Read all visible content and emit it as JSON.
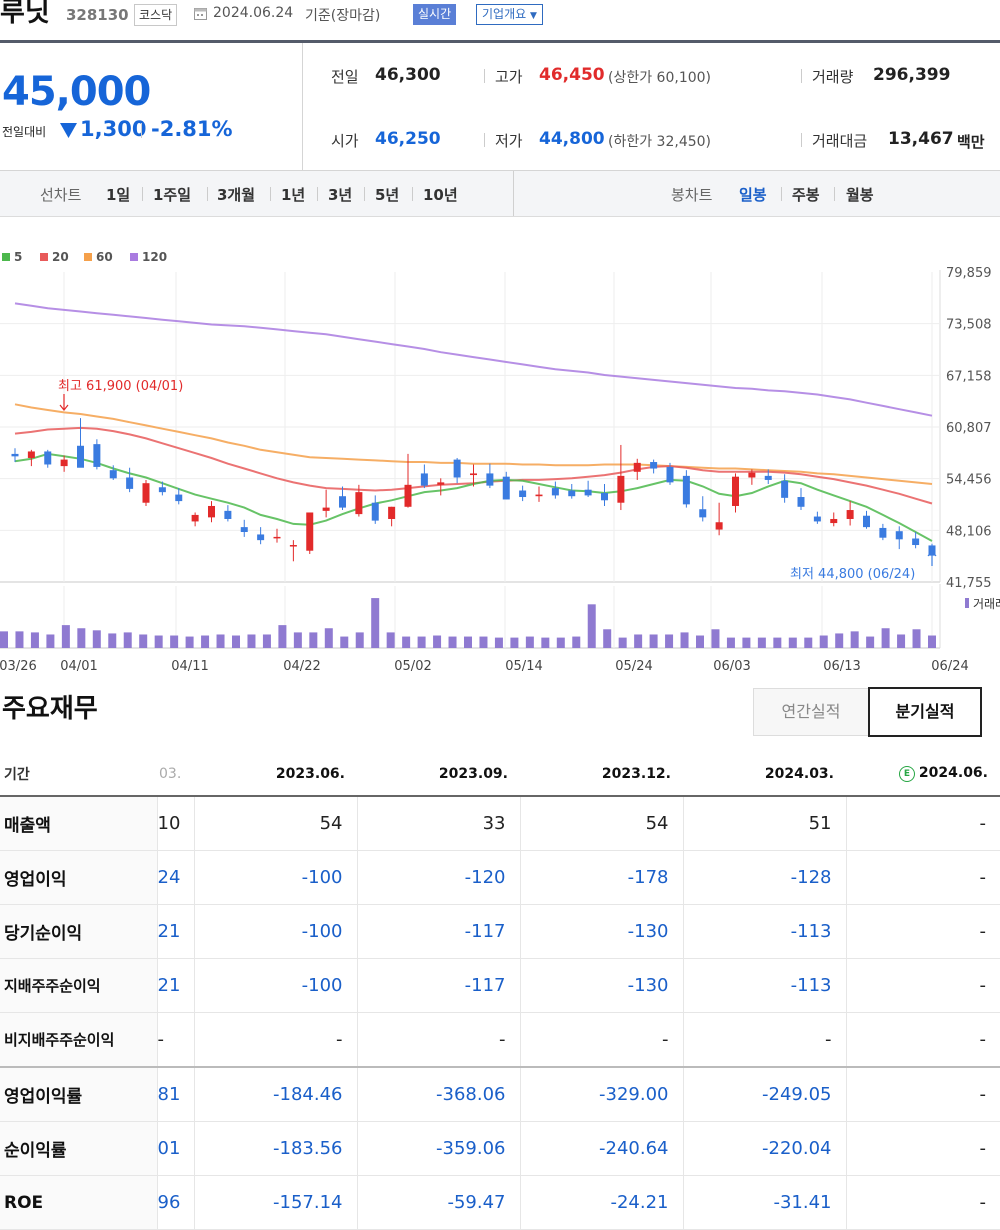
{
  "header": {
    "stock_name": "루닛",
    "stock_code": "328130",
    "market": "코스닥",
    "base_date": "2024.06.24",
    "base_label": "기준(장마감)",
    "realtime_label": "실시간",
    "company_label": "기업개요"
  },
  "price": {
    "current": "45,000",
    "change_label": "전일대비",
    "change_amount": "1,300",
    "change_rate": "-2.81%",
    "prev_close_label": "전일",
    "prev_close": "46,300",
    "open_label": "시가",
    "open": "46,250",
    "high_label": "고가",
    "high": "46,450",
    "upper_limit": "(상한가 60,100)",
    "low_label": "저가",
    "low": "44,800",
    "lower_limit": "(하한가 32,450)",
    "volume_label": "거래량",
    "volume": "296,399",
    "amount_label": "거래대금",
    "amount": "13,467",
    "amount_unit": "백만"
  },
  "period_bar": {
    "line_label": "선차트",
    "line_items": [
      "1일",
      "1주일",
      "3개월",
      "1년",
      "3년",
      "5년",
      "10년"
    ],
    "candle_label": "봉차트",
    "candle_items": [
      "일봉",
      "주봉",
      "월봉"
    ],
    "active_candle": "일봉"
  },
  "chart_data": {
    "type": "candlestick",
    "legend": [
      {
        "name": "5",
        "color": "#4cb84c"
      },
      {
        "name": "20",
        "color": "#e85a5a"
      },
      {
        "name": "60",
        "color": "#f5a04a"
      },
      {
        "name": "120",
        "color": "#a97be0"
      }
    ],
    "y_ticks": [
      "79,859",
      "73,508",
      "67,158",
      "60,807",
      "54,456",
      "48,106",
      "41,755"
    ],
    "ylim": [
      41755,
      79859
    ],
    "x_ticks": [
      "03/26",
      "04/01",
      "04/11",
      "04/22",
      "05/02",
      "05/14",
      "05/24",
      "06/03",
      "06/13",
      "06/24"
    ],
    "high_annotation": "최고 61,900 (04/01)",
    "low_annotation": "최저 44,800 (06/24)",
    "volume_label": "거래래",
    "candles": [
      {
        "o": 57500,
        "h": 58200,
        "l": 56500,
        "c": 57200
      },
      {
        "o": 57000,
        "h": 58000,
        "l": 56000,
        "c": 57800
      },
      {
        "o": 57800,
        "h": 58000,
        "l": 55800,
        "c": 56200
      },
      {
        "o": 56000,
        "h": 57300,
        "l": 55300,
        "c": 56800
      },
      {
        "o": 58500,
        "h": 61900,
        "l": 56300,
        "c": 55800
      },
      {
        "o": 58700,
        "h": 59300,
        "l": 55600,
        "c": 55900
      },
      {
        "o": 55500,
        "h": 56100,
        "l": 54300,
        "c": 54500
      },
      {
        "o": 54600,
        "h": 55800,
        "l": 52800,
        "c": 53200
      },
      {
        "o": 51500,
        "h": 54300,
        "l": 51100,
        "c": 53900
      },
      {
        "o": 53400,
        "h": 54100,
        "l": 52400,
        "c": 52800
      },
      {
        "o": 52500,
        "h": 53300,
        "l": 51300,
        "c": 51700
      },
      {
        "o": 49200,
        "h": 50300,
        "l": 48600,
        "c": 50000
      },
      {
        "o": 49700,
        "h": 51700,
        "l": 49100,
        "c": 51100
      },
      {
        "o": 50500,
        "h": 51200,
        "l": 49200,
        "c": 49500
      },
      {
        "o": 48500,
        "h": 49400,
        "l": 47300,
        "c": 47900
      },
      {
        "o": 47600,
        "h": 48500,
        "l": 46400,
        "c": 46900
      },
      {
        "o": 47200,
        "h": 48300,
        "l": 46600,
        "c": 47300
      },
      {
        "o": 46300,
        "h": 46900,
        "l": 44300,
        "c": 46300
      },
      {
        "o": 45600,
        "h": 50300,
        "l": 45200,
        "c": 50300
      },
      {
        "o": 50500,
        "h": 53100,
        "l": 49700,
        "c": 50900
      },
      {
        "o": 52300,
        "h": 53500,
        "l": 50600,
        "c": 50900
      },
      {
        "o": 50100,
        "h": 53700,
        "l": 49800,
        "c": 52800
      },
      {
        "o": 51500,
        "h": 52400,
        "l": 48900,
        "c": 49300
      },
      {
        "o": 49500,
        "h": 51000,
        "l": 48600,
        "c": 51000
      },
      {
        "o": 51000,
        "h": 57500,
        "l": 50900,
        "c": 53700
      },
      {
        "o": 55100,
        "h": 56200,
        "l": 53300,
        "c": 53600
      },
      {
        "o": 53700,
        "h": 54500,
        "l": 52400,
        "c": 54000
      },
      {
        "o": 56800,
        "h": 57000,
        "l": 53900,
        "c": 54600
      },
      {
        "o": 54900,
        "h": 56200,
        "l": 53500,
        "c": 55100
      },
      {
        "o": 55100,
        "h": 56300,
        "l": 53300,
        "c": 53600
      },
      {
        "o": 54700,
        "h": 55300,
        "l": 51900,
        "c": 51900
      },
      {
        "o": 53000,
        "h": 53600,
        "l": 51700,
        "c": 52200
      },
      {
        "o": 52300,
        "h": 53500,
        "l": 51600,
        "c": 52500
      },
      {
        "o": 53300,
        "h": 54100,
        "l": 52000,
        "c": 52400
      },
      {
        "o": 53000,
        "h": 53800,
        "l": 52000,
        "c": 52300
      },
      {
        "o": 53100,
        "h": 54200,
        "l": 52200,
        "c": 52400
      },
      {
        "o": 52700,
        "h": 53800,
        "l": 51100,
        "c": 51800
      },
      {
        "o": 51500,
        "h": 58600,
        "l": 50600,
        "c": 54800
      },
      {
        "o": 55300,
        "h": 56900,
        "l": 54300,
        "c": 56400
      },
      {
        "o": 56500,
        "h": 56800,
        "l": 55100,
        "c": 55700
      },
      {
        "o": 55900,
        "h": 56400,
        "l": 53700,
        "c": 54000
      },
      {
        "o": 54800,
        "h": 55500,
        "l": 50900,
        "c": 51300
      },
      {
        "o": 50700,
        "h": 52300,
        "l": 49200,
        "c": 49700
      },
      {
        "o": 48200,
        "h": 51500,
        "l": 47500,
        "c": 49100
      },
      {
        "o": 51100,
        "h": 55100,
        "l": 50300,
        "c": 54700
      },
      {
        "o": 54600,
        "h": 55600,
        "l": 53700,
        "c": 55200
      },
      {
        "o": 54800,
        "h": 55600,
        "l": 53800,
        "c": 54300
      },
      {
        "o": 54200,
        "h": 55000,
        "l": 51500,
        "c": 52100
      },
      {
        "o": 52200,
        "h": 53300,
        "l": 50600,
        "c": 51000
      },
      {
        "o": 49800,
        "h": 50400,
        "l": 48900,
        "c": 49200
      },
      {
        "o": 49000,
        "h": 50300,
        "l": 48600,
        "c": 49500
      },
      {
        "o": 49500,
        "h": 51700,
        "l": 48700,
        "c": 50600
      },
      {
        "o": 49900,
        "h": 50500,
        "l": 48300,
        "c": 48500
      },
      {
        "o": 48400,
        "h": 48900,
        "l": 46900,
        "c": 47200
      },
      {
        "o": 48000,
        "h": 48600,
        "l": 45800,
        "c": 47000
      },
      {
        "o": 47100,
        "h": 47900,
        "l": 45900,
        "c": 46300
      },
      {
        "o": 46250,
        "h": 46450,
        "l": 44800,
        "c": 45000
      }
    ],
    "ma5": [
      56600,
      56900,
      57500,
      57200,
      56900,
      56400,
      55700,
      55100,
      54600,
      53900,
      53200,
      52500,
      52000,
      51500,
      50900,
      50000,
      49500,
      48900,
      48800,
      49300,
      50100,
      50800,
      51400,
      51800,
      52300,
      52800,
      53000,
      53300,
      53800,
      54200,
      54300,
      54200,
      53800,
      53400,
      53000,
      52900,
      52700,
      52900,
      53300,
      53800,
      54300,
      54200,
      53500,
      52600,
      52300,
      52700,
      53500,
      54200,
      53900,
      53100,
      52400,
      51700,
      51000,
      50000,
      49000,
      47900,
      46800
    ],
    "ma20": [
      60000,
      60200,
      60500,
      60600,
      60700,
      60600,
      60300,
      59900,
      59400,
      58800,
      58200,
      57600,
      57000,
      56300,
      55700,
      55100,
      54500,
      54000,
      53600,
      53300,
      53200,
      53100,
      53000,
      53100,
      53300,
      53500,
      53700,
      53800,
      53900,
      54100,
      54200,
      54300,
      54300,
      54400,
      54500,
      54700,
      54900,
      55200,
      55600,
      55900,
      56000,
      55800,
      55500,
      55300,
      55300,
      55300,
      55300,
      55200,
      55000,
      54700,
      54400,
      54000,
      53600,
      53100,
      52600,
      52000,
      51400
    ],
    "ma60": [
      63600,
      63200,
      62900,
      62600,
      62400,
      62100,
      61800,
      61400,
      61000,
      60600,
      60200,
      59800,
      59400,
      58900,
      58500,
      58000,
      57700,
      57400,
      57100,
      57000,
      56900,
      56800,
      56700,
      56600,
      56500,
      56500,
      56400,
      56400,
      56300,
      56300,
      56300,
      56200,
      56200,
      56100,
      56100,
      56100,
      56200,
      56200,
      56200,
      56100,
      56000,
      55900,
      55800,
      55700,
      55700,
      55600,
      55500,
      55400,
      55300,
      55100,
      55000,
      54800,
      54600,
      54400,
      54200,
      54000,
      53800
    ],
    "ma120": [
      76000,
      75700,
      75400,
      75200,
      75000,
      74800,
      74600,
      74400,
      74200,
      74000,
      73800,
      73600,
      73400,
      73300,
      73200,
      73000,
      72800,
      72600,
      72400,
      72200,
      71900,
      71600,
      71300,
      71000,
      70700,
      70400,
      70000,
      69700,
      69400,
      69100,
      68800,
      68500,
      68200,
      67900,
      67700,
      67500,
      67200,
      67000,
      66800,
      66600,
      66400,
      66200,
      66000,
      65800,
      65600,
      65500,
      65300,
      65200,
      65000,
      64800,
      64500,
      64200,
      63800,
      63400,
      63000,
      62600,
      62200
    ],
    "volumes": [
      16,
      16,
      15,
      13,
      22,
      19,
      17,
      14,
      15,
      13,
      12,
      12,
      11,
      12,
      13,
      12,
      13,
      13,
      22,
      15,
      15,
      19,
      11,
      15,
      48,
      15,
      11,
      11,
      12,
      11,
      11,
      11,
      10,
      10,
      11,
      10,
      10,
      11,
      42,
      18,
      10,
      13,
      13,
      13,
      15,
      12,
      18,
      10,
      10,
      10,
      10,
      10,
      10,
      12,
      14,
      16,
      11,
      19,
      13,
      18,
      12
    ]
  },
  "financials": {
    "title": "주요재무",
    "tab_annual": "연간실적",
    "tab_quarter": "분기실적",
    "header_label": "기간",
    "columns": [
      "03.",
      "2023.06.",
      "2023.09.",
      "2023.12.",
      "2024.03.",
      "2024.06."
    ],
    "estimate_icon": "E",
    "rows": [
      {
        "label": "매출액",
        "values": [
          "10",
          "54",
          "33",
          "54",
          "51",
          "-"
        ]
      },
      {
        "label": "영업이익",
        "values": [
          "24",
          "-100",
          "-120",
          "-178",
          "-128",
          "-"
        ]
      },
      {
        "label": "당기순이익",
        "values": [
          "21",
          "-100",
          "-117",
          "-130",
          "-113",
          "-"
        ]
      },
      {
        "label": "지배주주순이익",
        "values": [
          "21",
          "-100",
          "-117",
          "-130",
          "-113",
          "-"
        ]
      },
      {
        "label": "비지배주주순이익",
        "values": [
          "-",
          "-",
          "-",
          "-",
          "-",
          "-"
        ]
      },
      {
        "label": "영업이익률",
        "values": [
          "81",
          "-184.46",
          "-368.06",
          "-329.00",
          "-249.05",
          "-"
        ]
      },
      {
        "label": "순이익률",
        "values": [
          "01",
          "-183.56",
          "-359.06",
          "-240.64",
          "-220.04",
          "-"
        ]
      },
      {
        "label": "ROE",
        "values": [
          "96",
          "-157.14",
          "-59.47",
          "-24.21",
          "-31.41",
          "-"
        ]
      }
    ]
  }
}
